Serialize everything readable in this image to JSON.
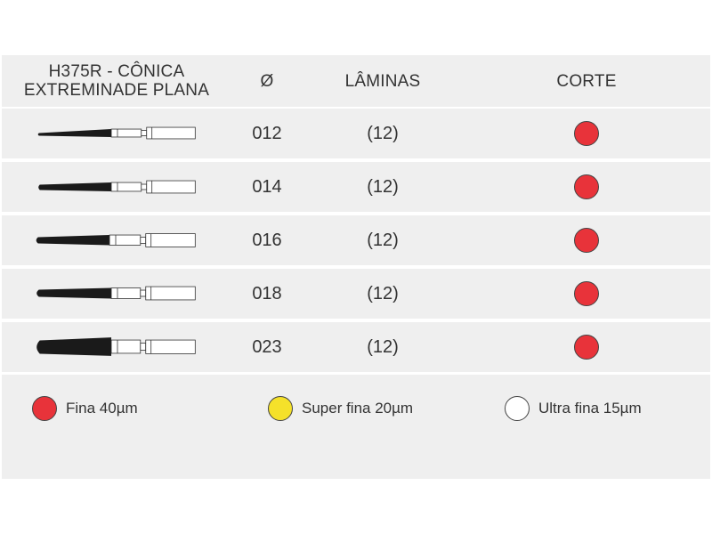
{
  "header": {
    "product_line1": "H375R - CÔNICA",
    "product_line2": "EXTREMINADE PLANA",
    "diameter": "Ø",
    "blades": "LÂMINAS",
    "cut": "CORTE"
  },
  "rows": [
    {
      "diameter": "012",
      "blades": "(12)",
      "cut_color": "#e8333a"
    },
    {
      "diameter": "014",
      "blades": "(12)",
      "cut_color": "#e8333a"
    },
    {
      "diameter": "016",
      "blades": "(12)",
      "cut_color": "#e8333a"
    },
    {
      "diameter": "018",
      "blades": "(12)",
      "cut_color": "#e8333a"
    },
    {
      "diameter": "023",
      "blades": "(12)",
      "cut_color": "#e8333a"
    }
  ],
  "legend": [
    {
      "label": "Fina 40µm",
      "color": "#e8333a"
    },
    {
      "label": "Super fina 20µm",
      "color": "#f5e12a"
    },
    {
      "label": "Ultra fina 15µm",
      "color": "#ffffff"
    }
  ]
}
